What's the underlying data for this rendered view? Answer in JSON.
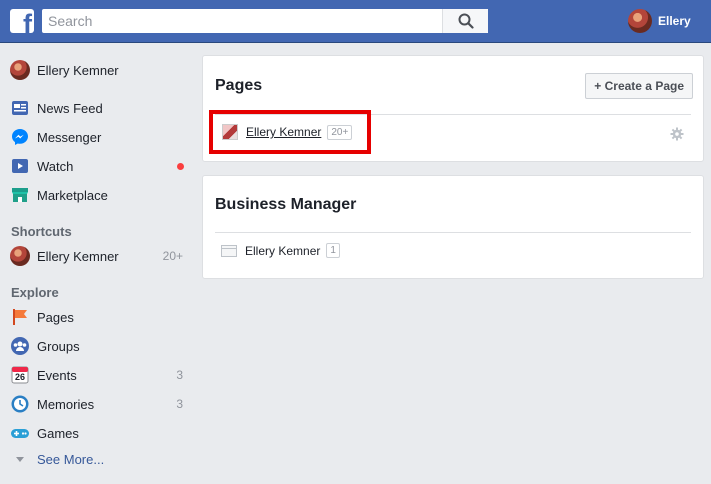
{
  "topbar": {
    "logo_letter": "f",
    "search": {
      "placeholder": "Search",
      "value": ""
    },
    "user_name": "Ellery"
  },
  "leftnav": {
    "profile_name": "Ellery Kemner",
    "main_items": [
      {
        "label": "News Feed",
        "icon": "news-feed-icon"
      },
      {
        "label": "Messenger",
        "icon": "messenger-icon"
      },
      {
        "label": "Watch",
        "icon": "watch-icon",
        "notification": true
      },
      {
        "label": "Marketplace",
        "icon": "marketplace-icon"
      }
    ],
    "shortcuts_header": "Shortcuts",
    "shortcuts": [
      {
        "label": "Ellery Kemner",
        "count": "20+"
      }
    ],
    "explore_header": "Explore",
    "explore": [
      {
        "label": "Pages",
        "icon": "pages-flag-icon",
        "count": ""
      },
      {
        "label": "Groups",
        "icon": "groups-icon",
        "count": ""
      },
      {
        "label": "Events",
        "icon": "calendar-icon",
        "count": "3",
        "calendar_day": "26"
      },
      {
        "label": "Memories",
        "icon": "memories-clock-icon",
        "count": "3"
      },
      {
        "label": "Games",
        "icon": "gamepad-icon",
        "count": ""
      }
    ],
    "see_more": "See More..."
  },
  "pages_card": {
    "title": "Pages",
    "create_label": "+ Create a Page",
    "page": {
      "name": "Ellery Kemner",
      "badge": "20+"
    }
  },
  "business_card": {
    "title": "Business Manager",
    "item": {
      "name": "Ellery Kemner",
      "badge": "1"
    }
  },
  "colors": {
    "topbar": "#4267b2",
    "background": "#e9ebee",
    "highlight": "#e60000",
    "link": "#365899"
  }
}
